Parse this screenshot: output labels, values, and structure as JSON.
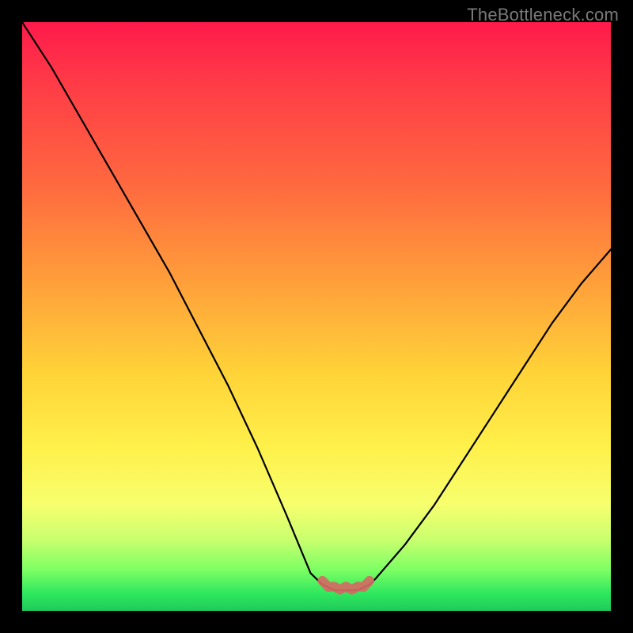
{
  "watermark": "TheBottleneck.com",
  "colors": {
    "background": "#000000",
    "curve": "#000000",
    "ridge": "#d46a63",
    "gradient_stops": [
      "#ff1a4b",
      "#ff3a47",
      "#ff6a3f",
      "#ffa23a",
      "#ffd438",
      "#fff04a",
      "#f7ff6e",
      "#c8ff6e",
      "#7dff64",
      "#2fe85e",
      "#1fca5a"
    ]
  },
  "chart_data": {
    "type": "line",
    "title": "",
    "xlabel": "",
    "ylabel": "",
    "xlim": [
      0,
      100
    ],
    "ylim": [
      0,
      100
    ],
    "x": [
      0,
      5,
      10,
      15,
      20,
      25,
      30,
      35,
      40,
      45,
      47,
      49,
      51,
      53,
      55,
      57,
      59,
      60,
      65,
      70,
      75,
      80,
      85,
      90,
      95,
      100
    ],
    "values": [
      100,
      92,
      83,
      74,
      65,
      56,
      46,
      36,
      25,
      13,
      8,
      3,
      1,
      0,
      0,
      0,
      1,
      2,
      8,
      15,
      23,
      31,
      39,
      47,
      54,
      60
    ],
    "flat_region_x": [
      51,
      59
    ],
    "annotations": []
  }
}
